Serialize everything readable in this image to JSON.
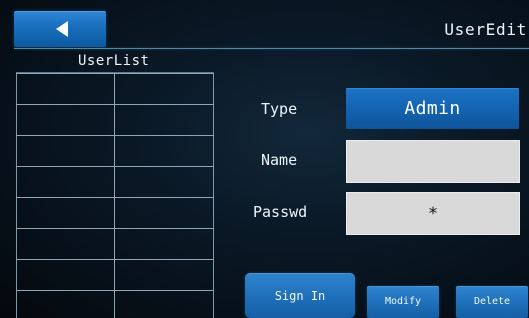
{
  "header": {
    "title": "UserEdit",
    "back_icon": "left-triangle-icon"
  },
  "user_list": {
    "title": "UserList",
    "rows": [
      [
        "",
        ""
      ],
      [
        "",
        ""
      ],
      [
        "",
        ""
      ],
      [
        "",
        ""
      ],
      [
        "",
        ""
      ],
      [
        "",
        ""
      ],
      [
        "",
        ""
      ],
      [
        "",
        ""
      ]
    ]
  },
  "form": {
    "type_label": "Type",
    "type_value": "Admin",
    "name_label": "Name",
    "name_value": "",
    "passwd_label": "Passwd",
    "passwd_value": "*"
  },
  "actions": {
    "sign_in": "Sign In",
    "modify": "Modify",
    "delete": "Delete"
  },
  "colors": {
    "accent": "#176db9",
    "field_background": "#d9d9d9",
    "text": "#eef4fa"
  }
}
